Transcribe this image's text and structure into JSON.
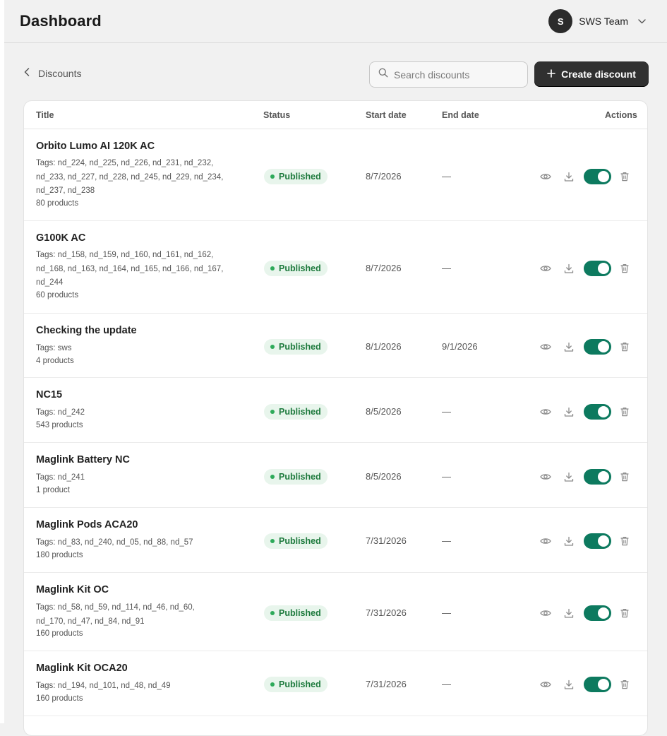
{
  "header": {
    "title": "Dashboard",
    "user": {
      "initial": "S",
      "name": "SWS Team"
    }
  },
  "toolbar": {
    "back_label": "Discounts",
    "search_placeholder": "Search discounts",
    "create_label": "Create discount"
  },
  "table": {
    "columns": {
      "title": "Title",
      "status": "Status",
      "start": "Start date",
      "end": "End date",
      "actions": "Actions"
    },
    "rows": [
      {
        "title": "Orbito Lumo AI 120K AC",
        "tags": "Tags: nd_224, nd_225, nd_226, nd_231, nd_232, nd_233, nd_227, nd_228, nd_245, nd_229, nd_234, nd_237, nd_238",
        "count": "80 products",
        "status": "Published",
        "start": "8/7/2026",
        "end": "—",
        "enabled": true
      },
      {
        "title": "G100K AC",
        "tags": "Tags: nd_158, nd_159, nd_160, nd_161, nd_162, nd_168, nd_163, nd_164, nd_165, nd_166, nd_167, nd_244",
        "count": "60 products",
        "status": "Published",
        "start": "8/7/2026",
        "end": "—",
        "enabled": true
      },
      {
        "title": "Checking the update",
        "tags": "Tags: sws",
        "count": "4 products",
        "status": "Published",
        "start": "8/1/2026",
        "end": "9/1/2026",
        "enabled": true
      },
      {
        "title": "NC15",
        "tags": "Tags: nd_242",
        "count": "543 products",
        "status": "Published",
        "start": "8/5/2026",
        "end": "—",
        "enabled": true
      },
      {
        "title": "Maglink Battery NC",
        "tags": "Tags: nd_241",
        "count": "1 product",
        "status": "Published",
        "start": "8/5/2026",
        "end": "—",
        "enabled": true
      },
      {
        "title": "Maglink Pods ACA20",
        "tags": "Tags: nd_83, nd_240, nd_05, nd_88, nd_57",
        "count": "180 products",
        "status": "Published",
        "start": "7/31/2026",
        "end": "—",
        "enabled": true
      },
      {
        "title": "Maglink Kit OC",
        "tags": "Tags: nd_58, nd_59, nd_114, nd_46, nd_60, nd_170, nd_47, nd_84, nd_91",
        "count": "160 products",
        "status": "Published",
        "start": "7/31/2026",
        "end": "—",
        "enabled": true
      },
      {
        "title": "Maglink Kit OCA20",
        "tags": "Tags: nd_194, nd_101, nd_48, nd_49",
        "count": "160 products",
        "status": "Published",
        "start": "7/31/2026",
        "end": "—",
        "enabled": true
      }
    ]
  },
  "colors": {
    "primary_button": "#303030",
    "toggle_on": "#0d7a5f",
    "published_badge_bg": "#e8f5ec",
    "published_badge_text": "#1d7a3d"
  },
  "icons": {
    "back": "chevron-left-icon",
    "search": "search-icon",
    "create": "plus-icon",
    "user_menu": "chevron-down-icon",
    "view": "eye-icon",
    "export": "download-icon",
    "delete": "trash-icon"
  }
}
